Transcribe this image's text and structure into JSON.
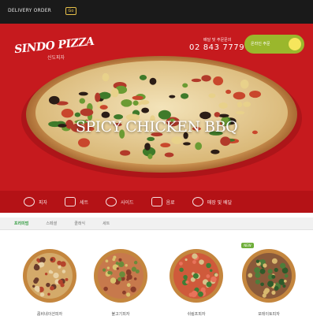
{
  "topbar": {
    "delivery_text": "DELIVERY ORDER",
    "badge_text": "Go"
  },
  "header": {
    "logo_text": "SINDO PIZZA",
    "logo_sub": "신도피자",
    "phone_caption": "배달 및 주문문의",
    "phone_number": "02 843 7779",
    "order_button": "온라인 주문"
  },
  "hero": {
    "title": "SPICY CHICKEN BBQ"
  },
  "menu": {
    "items": [
      {
        "label": "피자",
        "icon": "pizza-icon"
      },
      {
        "label": "세트",
        "icon": "box-icon"
      },
      {
        "label": "사이드",
        "icon": "cup-icon"
      },
      {
        "label": "음료",
        "icon": "drink-icon"
      },
      {
        "label": "매장 및 배달",
        "icon": "store-icon"
      }
    ]
  },
  "tabs": [
    {
      "label": "프리미엄",
      "active": true
    },
    {
      "label": "스페셜",
      "active": false
    },
    {
      "label": "클래식",
      "active": false
    },
    {
      "label": "세트",
      "active": false
    }
  ],
  "products": [
    {
      "name": "콤비네이션피자",
      "new": false,
      "base": "#d4aa6a",
      "toppings": [
        "#b5442c",
        "#e8d2a6",
        "#6a3b2b"
      ]
    },
    {
      "name": "불고기피자",
      "new": false,
      "base": "#c7794c",
      "toppings": [
        "#8a3d2a",
        "#6a8b3a",
        "#d9c36e"
      ]
    },
    {
      "name": "쉬림프피자",
      "new": false,
      "base": "#cf5a3b",
      "toppings": [
        "#e8735b",
        "#3f7e35",
        "#d8c18a"
      ]
    },
    {
      "name": "포테이토피자",
      "new": true,
      "new_label": "NEW",
      "base": "#8a5a3a",
      "toppings": [
        "#4e7d3a",
        "#2f5a2a",
        "#d8b86e"
      ]
    }
  ],
  "colors": {
    "brand_red": "#c61a1e",
    "accent_green": "#9ab72c",
    "tab_active": "#2f9a3d"
  }
}
